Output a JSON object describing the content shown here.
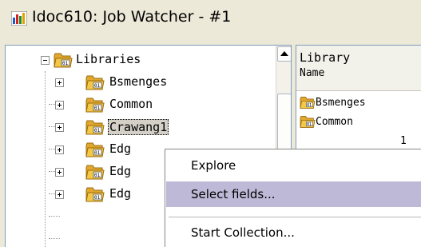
{
  "window": {
    "title": "Idoc610:  Job Watcher - #1",
    "icon": "app-chart-icon"
  },
  "tree": {
    "root": {
      "label": "Libraries",
      "expanded": true,
      "icon": "library-folder-icon"
    },
    "items": [
      {
        "label": "Bsmenges",
        "expanded": false
      },
      {
        "label": "Common",
        "expanded": false
      },
      {
        "label": "Crawang1",
        "expanded": false,
        "selected": true
      },
      {
        "label": "Edg",
        "expanded": false
      },
      {
        "label": "Edg",
        "expanded": false
      },
      {
        "label": "Edg",
        "expanded": false
      }
    ]
  },
  "list": {
    "column_header_line1": "Library",
    "column_header_line2": "Name",
    "rows": [
      {
        "label": "Bsmenges"
      },
      {
        "label": "Common"
      },
      {
        "label": "1"
      }
    ]
  },
  "context_menu": {
    "items": [
      {
        "label": "Explore",
        "highlighted": false
      },
      {
        "label": "Select fields...",
        "highlighted": true
      },
      {
        "label": "Start Collection...",
        "highlighted": false
      }
    ]
  },
  "colors": {
    "menu_highlight": "#bdb9d6",
    "pane_border": "#7f9db9",
    "folder_yellow": "#f3c846"
  }
}
